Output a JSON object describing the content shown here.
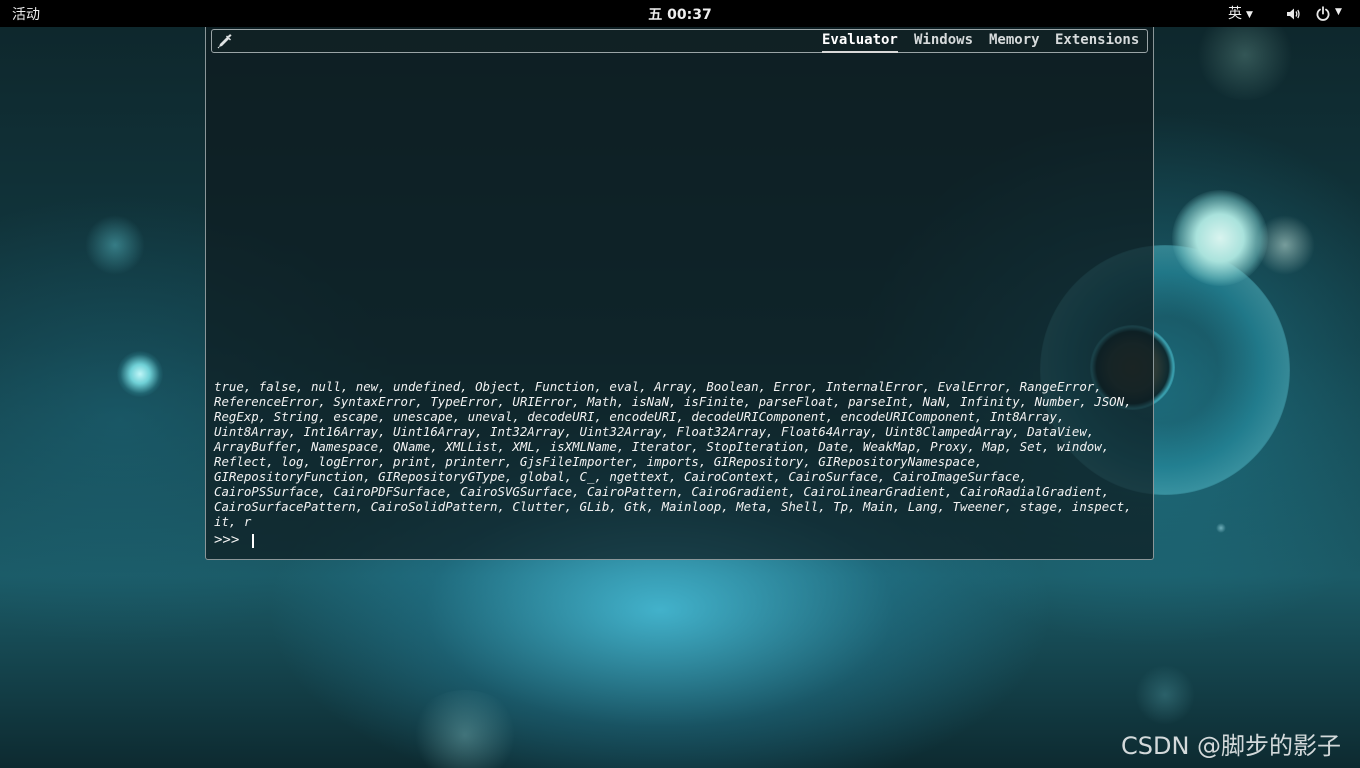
{
  "topbar": {
    "activities_label": "活动",
    "clock": "五 00:37",
    "input_method": "英",
    "volume_icon": "audio-volume-icon",
    "power_icon": "power-icon"
  },
  "looking_glass": {
    "picker_icon": "eyedropper-icon",
    "tabs": [
      {
        "label": "Evaluator",
        "active": true
      },
      {
        "label": "Windows",
        "active": false
      },
      {
        "label": "Memory",
        "active": false
      },
      {
        "label": "Extensions",
        "active": false
      }
    ],
    "output": "true, false, null, new, undefined, Object, Function, eval, Array, Boolean, Error, InternalError, EvalError, RangeError, ReferenceError, SyntaxError, TypeError, URIError, Math, isNaN, isFinite, parseFloat, parseInt, NaN, Infinity, Number, JSON, RegExp, String, escape, unescape, uneval, decodeURI, encodeURI, decodeURIComponent, encodeURIComponent, Int8Array, Uint8Array, Int16Array, Uint16Array, Int32Array, Uint32Array, Float32Array, Float64Array, Uint8ClampedArray, DataView, ArrayBuffer, Namespace, QName, XMLList, XML, isXMLName, Iterator, StopIteration, Date, WeakMap, Proxy, Map, Set, window, Reflect, log, logError, print, printerr, GjsFileImporter, imports, GIRepository, GIRepositoryNamespace, GIRepositoryFunction, GIRepositoryGType, global, C_, ngettext, CairoContext, CairoSurface, CairoImageSurface, CairoPSSurface, CairoPDFSurface, CairoSVGSurface, CairoPattern, CairoGradient, CairoLinearGradient, CairoRadialGradient, CairoSurfacePattern, CairoSolidPattern, Clutter, GLib, Gtk, Mainloop, Meta, Shell, Tp, Main, Lang, Tweener, stage, inspect, it, r",
    "prompt": ">>>",
    "input_value": ""
  },
  "watermark": "CSDN @脚步的影子",
  "colors": {
    "topbar_bg": "#000000",
    "accent": "#5fd8f0"
  }
}
